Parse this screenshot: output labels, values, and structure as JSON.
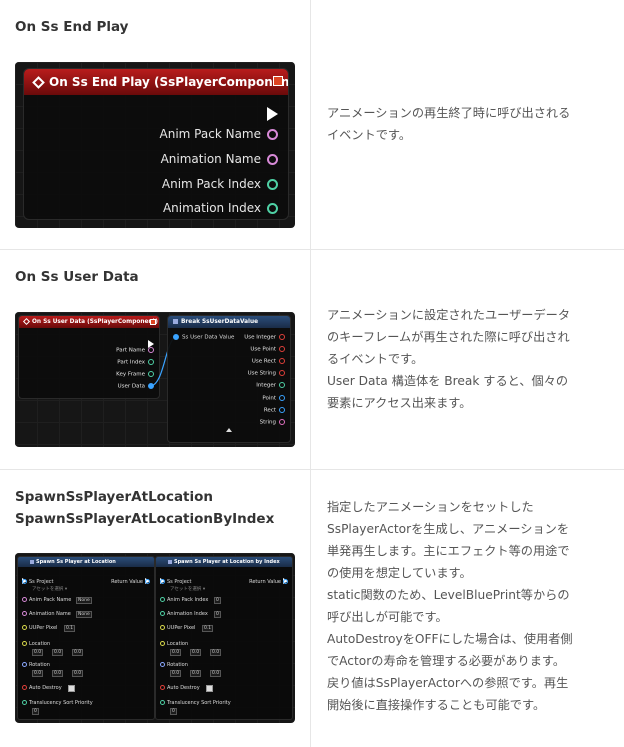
{
  "rows": [
    {
      "title": "On Ss End Play",
      "desc": [
        "アニメーションの再生終了時に呼び出される",
        "イベントです。"
      ],
      "node": {
        "header": "On Ss End Play (SsPlayerComponent)",
        "pins": [
          "Anim Pack Name",
          "Animation Name",
          "Anim Pack Index",
          "Animation Index"
        ]
      }
    },
    {
      "title": "On Ss User Data",
      "desc": [
        "アニメーションに設定されたユーザーデータ",
        "のキーフレームが再生された際に呼び出され",
        "るイベントです。",
        "User Data 構造体を Break すると、個々の",
        "要素にアクセス出来ます。"
      ],
      "event_node": {
        "header": "On Ss User Data (SsPlayerComponent)",
        "pins": [
          "Part Name",
          "Part Index",
          "Key Frame",
          "User Data"
        ]
      },
      "break_node": {
        "header": "Break SsUserDataValue",
        "input": "Ss User Data Value",
        "pins": [
          "Use Integer",
          "Use Point",
          "Use Rect",
          "Use String",
          "Integer",
          "Point",
          "Rect",
          "String"
        ]
      }
    },
    {
      "title_lines": [
        "SpawnSsPlayerAtLocation",
        "SpawnSsPlayerAtLocationByIndex"
      ],
      "desc": [
        "指定したアニメーションをセットした",
        "SsPlayerActorを生成し、アニメーションを",
        "単発再生します。主にエフェクト等の用途で",
        "の使用を想定しています。",
        "static関数のため、LevelBluePrint等からの",
        "呼び出しが可能です。",
        "AutoDestroyをOFFにした場合は、使用者側",
        "でActorの寿命を管理する必要があります。",
        "戻り値はSsPlayerActorへの参照です。再生",
        "開始後に直接操作することも可能です。"
      ],
      "spawn_nodes": [
        {
          "header": "Spawn Ss Player at Location",
          "project_label": "Ss Project",
          "project_value": "アセットを選択 ▾",
          "return_label": "Return Value",
          "field1_label": "Anim Pack Name",
          "field1_value": "None",
          "field2_label": "Animation Name",
          "field2_value": "None",
          "uu_label": "UUPer Pixel",
          "uu_value": "0.1",
          "location_label": "Location",
          "rotation_label": "Rotation",
          "vec_value": "0.0",
          "auto_label": "Auto Destroy",
          "sort_label": "Translucency Sort Priority",
          "sort_value": "0"
        },
        {
          "header": "Spawn Ss Player at Location by Index",
          "project_label": "Ss Project",
          "project_value": "アセットを選択 ▾",
          "return_label": "Return Value",
          "field1_label": "Anim Pack Index",
          "field1_value": "0",
          "field2_label": "Animation Index",
          "field2_value": "0",
          "uu_label": "UUPer Pixel",
          "uu_value": "0.1",
          "location_label": "Location",
          "rotation_label": "Rotation",
          "vec_value": "0.0",
          "auto_label": "Auto Destroy",
          "sort_label": "Translucency Sort Priority",
          "sort_value": "0"
        }
      ]
    }
  ],
  "colors": {
    "pin_pink": "#d88ad8",
    "pin_green": "#4fd1a5",
    "pin_blue": "#3aa3ff",
    "pin_red": "#e0403a",
    "pin_yellow": "#d8d84a",
    "node_red": "#b81c1c",
    "node_blue": "#2b4d7a"
  }
}
